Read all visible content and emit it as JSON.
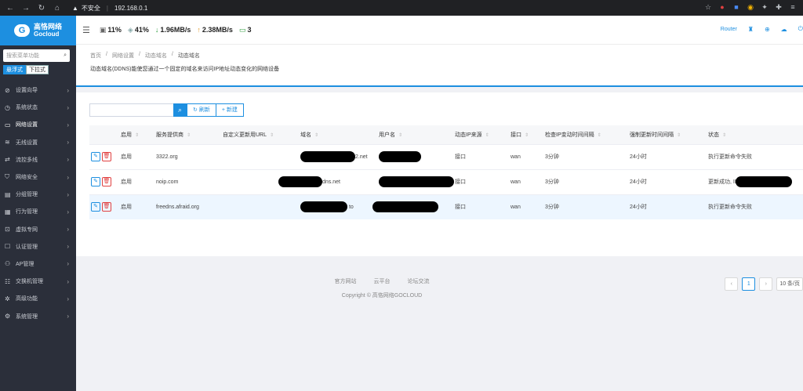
{
  "browser": {
    "insecure_label": "不安全",
    "url": "192.168.0.1"
  },
  "sidebar": {
    "brand_cn": "高恪网络",
    "brand_en": "Gocloud",
    "search_placeholder": "搜索菜单功能",
    "mode_float": "悬浮式",
    "mode_dropdown": "下拉式",
    "items": [
      {
        "label": "设置向导",
        "icon": "compass-icon"
      },
      {
        "label": "系统状态",
        "icon": "clock-icon"
      },
      {
        "label": "网络设置",
        "icon": "monitor-icon"
      },
      {
        "label": "无线设置",
        "icon": "wifi-icon"
      },
      {
        "label": "流控多线",
        "icon": "flow-icon"
      },
      {
        "label": "网络安全",
        "icon": "shield-icon"
      },
      {
        "label": "分组管理",
        "icon": "group-icon"
      },
      {
        "label": "行为管理",
        "icon": "behavior-icon"
      },
      {
        "label": "虚拟专网",
        "icon": "vpn-icon"
      },
      {
        "label": "认证管理",
        "icon": "auth-icon"
      },
      {
        "label": "AP管理",
        "icon": "ap-icon"
      },
      {
        "label": "交换机管理",
        "icon": "switch-icon"
      },
      {
        "label": "高级功能",
        "icon": "advanced-icon"
      },
      {
        "label": "系统管理",
        "icon": "gear-icon"
      }
    ]
  },
  "topbar": {
    "cpu": "11%",
    "mem": "41%",
    "download": "1.96MB/s",
    "upload": "2.38MB/s",
    "devices": "3",
    "router_label": "Router"
  },
  "page": {
    "breadcrumb": [
      "首页",
      "网络设置",
      "动态域名",
      "动态域名"
    ],
    "description": "动态域名(DDNS)能使您通过一个固定的域名来访问IP地址动态变化的网络设备"
  },
  "toolbar": {
    "refresh_label": "刷新",
    "new_label": "新建"
  },
  "table": {
    "headers": [
      "启用",
      "服务提供商",
      "自定义更新用URL",
      "域名",
      "用户名",
      "动态IP来源",
      "接口",
      "检查IP变动时间间隔",
      "强制更新时间间隔",
      "状态"
    ],
    "rows": [
      {
        "enabled": "启用",
        "provider": "3322.org",
        "url": "",
        "domain_suffix": "2.net",
        "source": "接口",
        "iface": "wan",
        "check": "3分钟",
        "force": "24小时",
        "status": "执行更新命令失败"
      },
      {
        "enabled": "启用",
        "provider": "noip.com",
        "url": "",
        "domain_suffix": "dns.net",
        "source": "接口",
        "iface": "wan",
        "check": "3分钟",
        "force": "24小时",
        "status": "更新成功, IP"
      },
      {
        "enabled": "启用",
        "provider": "freedns.afraid.org",
        "url": "",
        "domain_suffix": "to",
        "source": "接口",
        "iface": "wan",
        "check": "3分钟",
        "force": "24小时",
        "status": "执行更新命令失败"
      }
    ]
  },
  "pager": {
    "current": "1",
    "page_size": "10 条/页"
  },
  "footer": {
    "links": [
      "官方网站",
      "云平台",
      "论坛交流"
    ],
    "copyright": "Copyright © 高恪网络GOCLOUD"
  },
  "colors": {
    "brand": "#1d8fe0",
    "sidebar_bg": "#2b2f3a"
  }
}
